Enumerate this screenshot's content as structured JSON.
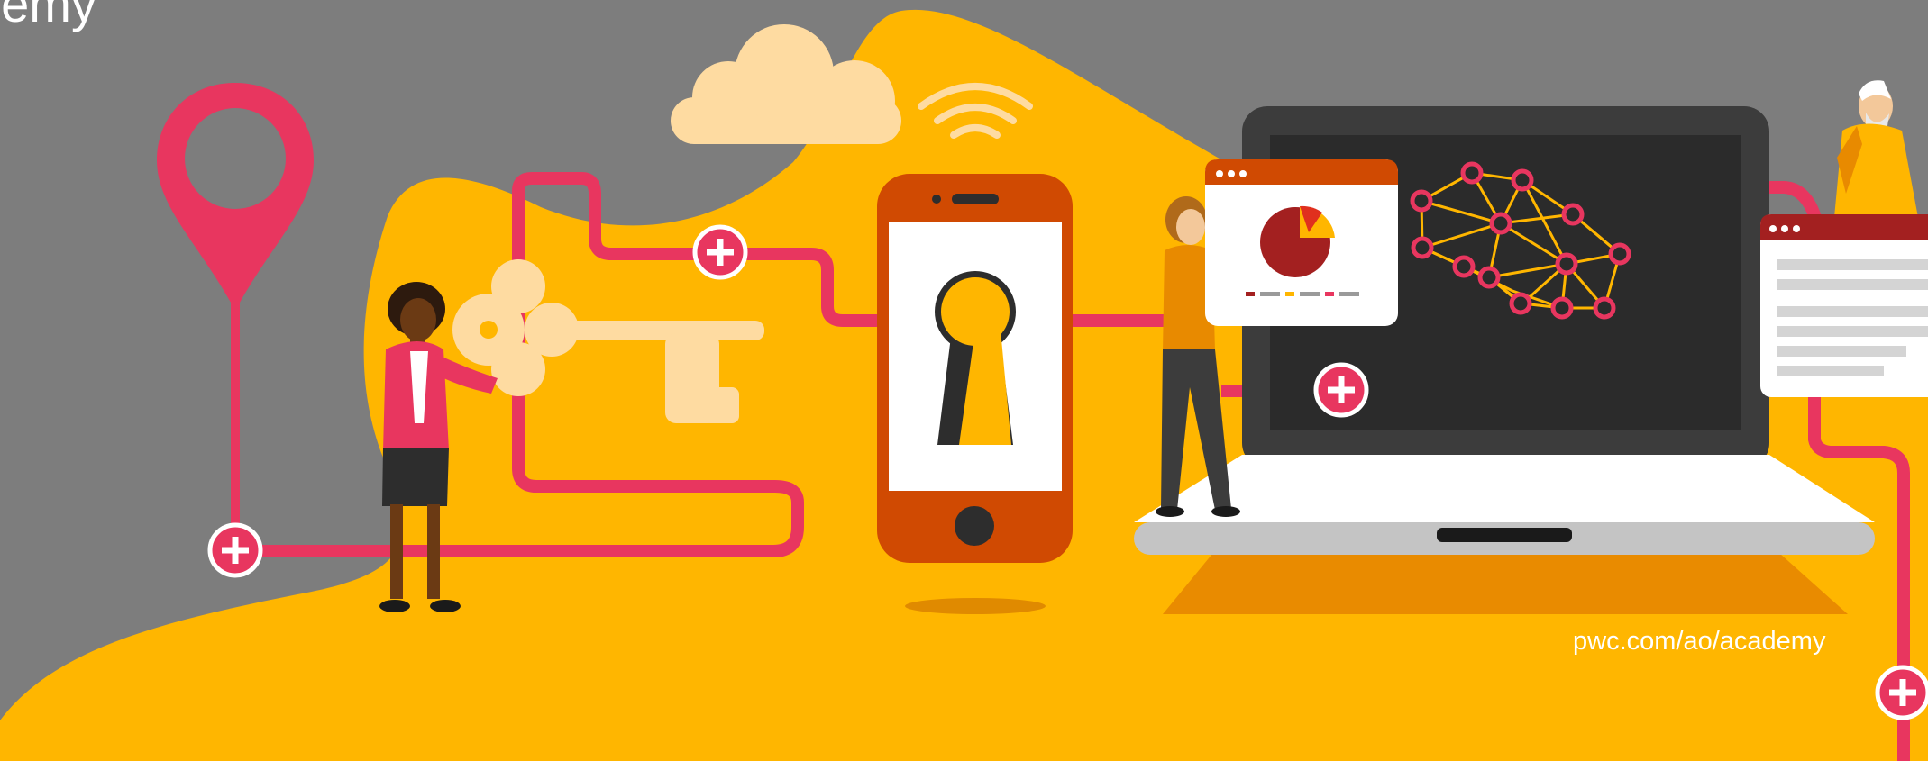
{
  "heading_fragment": "demy",
  "footer": {
    "url": "pwc.com/ao/academy"
  },
  "icons": [
    "location-pin-icon",
    "key-icon",
    "cloud-icon",
    "wifi-icon",
    "smartphone-icon",
    "keyhole-icon",
    "laptop-icon",
    "neural-network-icon",
    "pie-chart-icon",
    "document-window-icon",
    "plus-icon"
  ],
  "colors": {
    "background": "#7d7d7d",
    "accent_yellow": "#ffb600",
    "accent_pink": "#e0301e",
    "path_pink": "#e8365f",
    "phone_orange": "#d04a02",
    "cream": "#fedba1"
  }
}
